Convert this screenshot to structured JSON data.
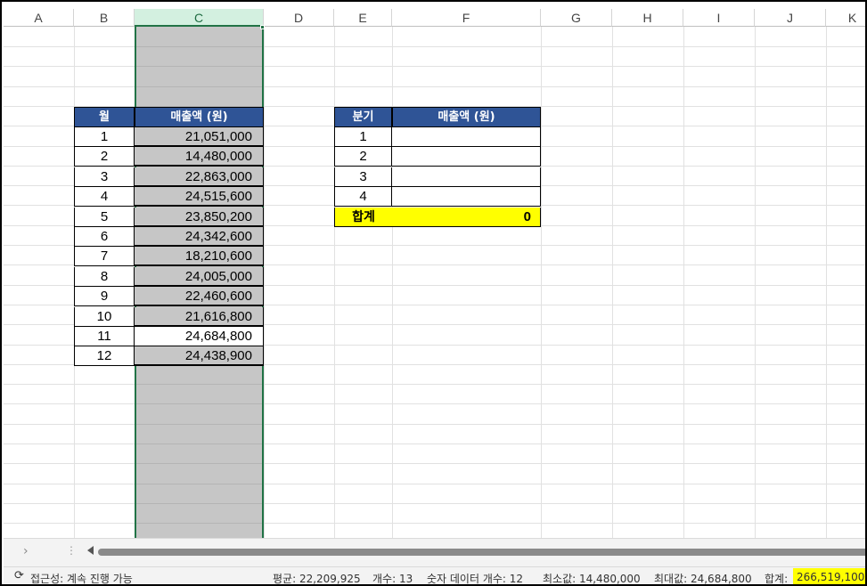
{
  "columns": [
    "A",
    "B",
    "C",
    "D",
    "E",
    "F",
    "G",
    "H",
    "I",
    "J",
    "K"
  ],
  "monthly_table": {
    "header_month": "월",
    "header_sales": "매출액 (원)",
    "rows": [
      {
        "month": "1",
        "sales": "21,051,000"
      },
      {
        "month": "2",
        "sales": "14,480,000"
      },
      {
        "month": "3",
        "sales": "22,863,000"
      },
      {
        "month": "4",
        "sales": "24,515,600"
      },
      {
        "month": "5",
        "sales": "23,850,200"
      },
      {
        "month": "6",
        "sales": "24,342,600"
      },
      {
        "month": "7",
        "sales": "18,210,600"
      },
      {
        "month": "8",
        "sales": "24,005,000"
      },
      {
        "month": "9",
        "sales": "22,460,600"
      },
      {
        "month": "10",
        "sales": "21,616,800"
      },
      {
        "month": "11",
        "sales": "24,684,800"
      },
      {
        "month": "12",
        "sales": "24,438,900"
      }
    ]
  },
  "quarter_table": {
    "header_quarter": "분기",
    "header_sales": "매출액 (원)",
    "rows": [
      {
        "quarter": "1",
        "sales": ""
      },
      {
        "quarter": "2",
        "sales": ""
      },
      {
        "quarter": "3",
        "sales": ""
      },
      {
        "quarter": "4",
        "sales": ""
      }
    ],
    "total_label": "합계",
    "total_value": "0"
  },
  "status": {
    "accessibility": "접근성: 계속 진행 가능",
    "average": "평균:  22,209,925",
    "count": "개수: 13",
    "numeric_count": "숫자 데이터 개수: 12",
    "min": "최소값:  14,480,000",
    "max": "최대값:  24,684,800",
    "sum_label": "합계:",
    "sum_value": "266,519,100"
  },
  "colors": {
    "header_blue": "#2f5496",
    "selection_green": "#217346",
    "total_yellow": "#ffff00",
    "selection_gray": "#c6c6c6"
  },
  "icons": [
    "accessibility-icon",
    "scroll-right-icon",
    "scroll-left-icon"
  ]
}
